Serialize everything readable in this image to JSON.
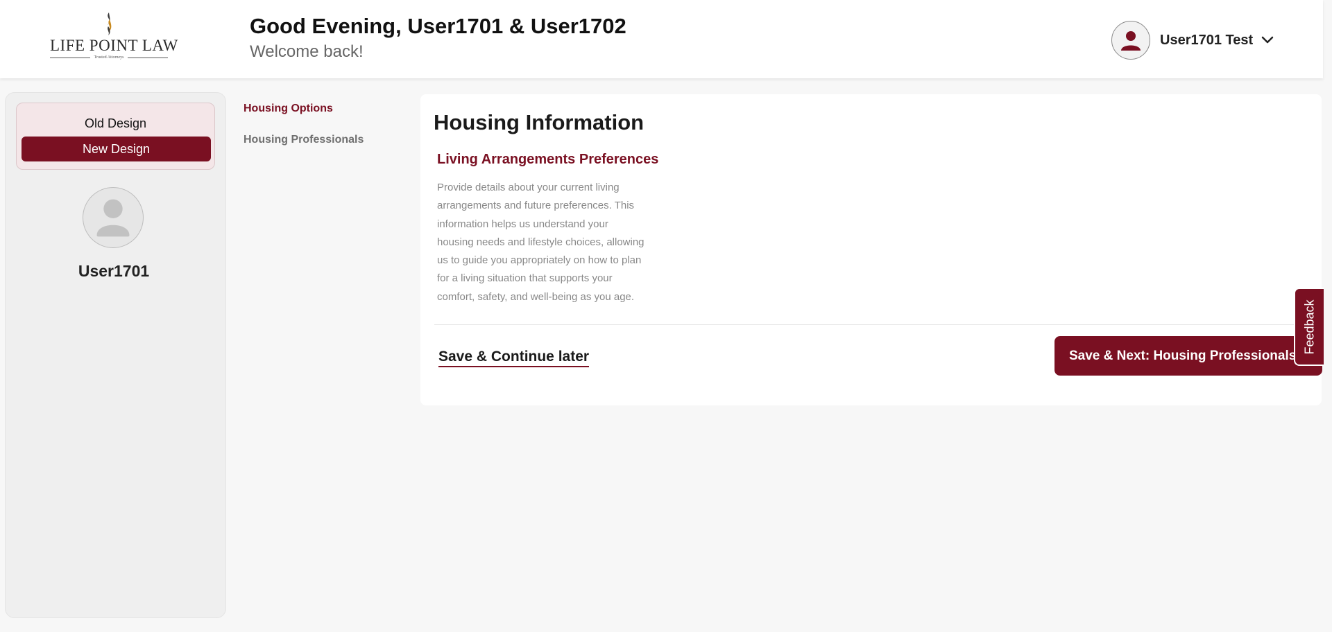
{
  "header": {
    "logo_name": "LIFE POINT LAW",
    "logo_tagline": "Trusted Attorneys",
    "greeting": "Good Evening, User1701 & User1702",
    "welcome": "Welcome back!",
    "user_menu_name": "User1701 Test",
    "user_icon": "user-avatar-icon",
    "menu_icon": "chevron-down-icon"
  },
  "sidebar": {
    "design_options": [
      "Old Design",
      "New Design"
    ],
    "selected_design": "New Design",
    "profile_name": "User1701"
  },
  "subnav": {
    "items": [
      {
        "label": "Housing Options",
        "active": true
      },
      {
        "label": "Housing Professionals",
        "active": false
      }
    ]
  },
  "main": {
    "title": "Housing Information",
    "section_title": "Living Arrangements Preferences",
    "section_description": "Provide details about your current living arrangements and future preferences. This information helps us understand your housing needs and lifestyle choices, allowing us to guide you appropriately on how to plan for a living situation that supports your comfort, safety, and well-being as you age.",
    "save_later_label": "Save & Continue later",
    "save_next_label": "Save & Next: Housing Professionals"
  },
  "feedback_label": "Feedback",
  "colors": {
    "brand": "#7a1022",
    "background": "#f7f7f7",
    "card": "#ffffff"
  }
}
